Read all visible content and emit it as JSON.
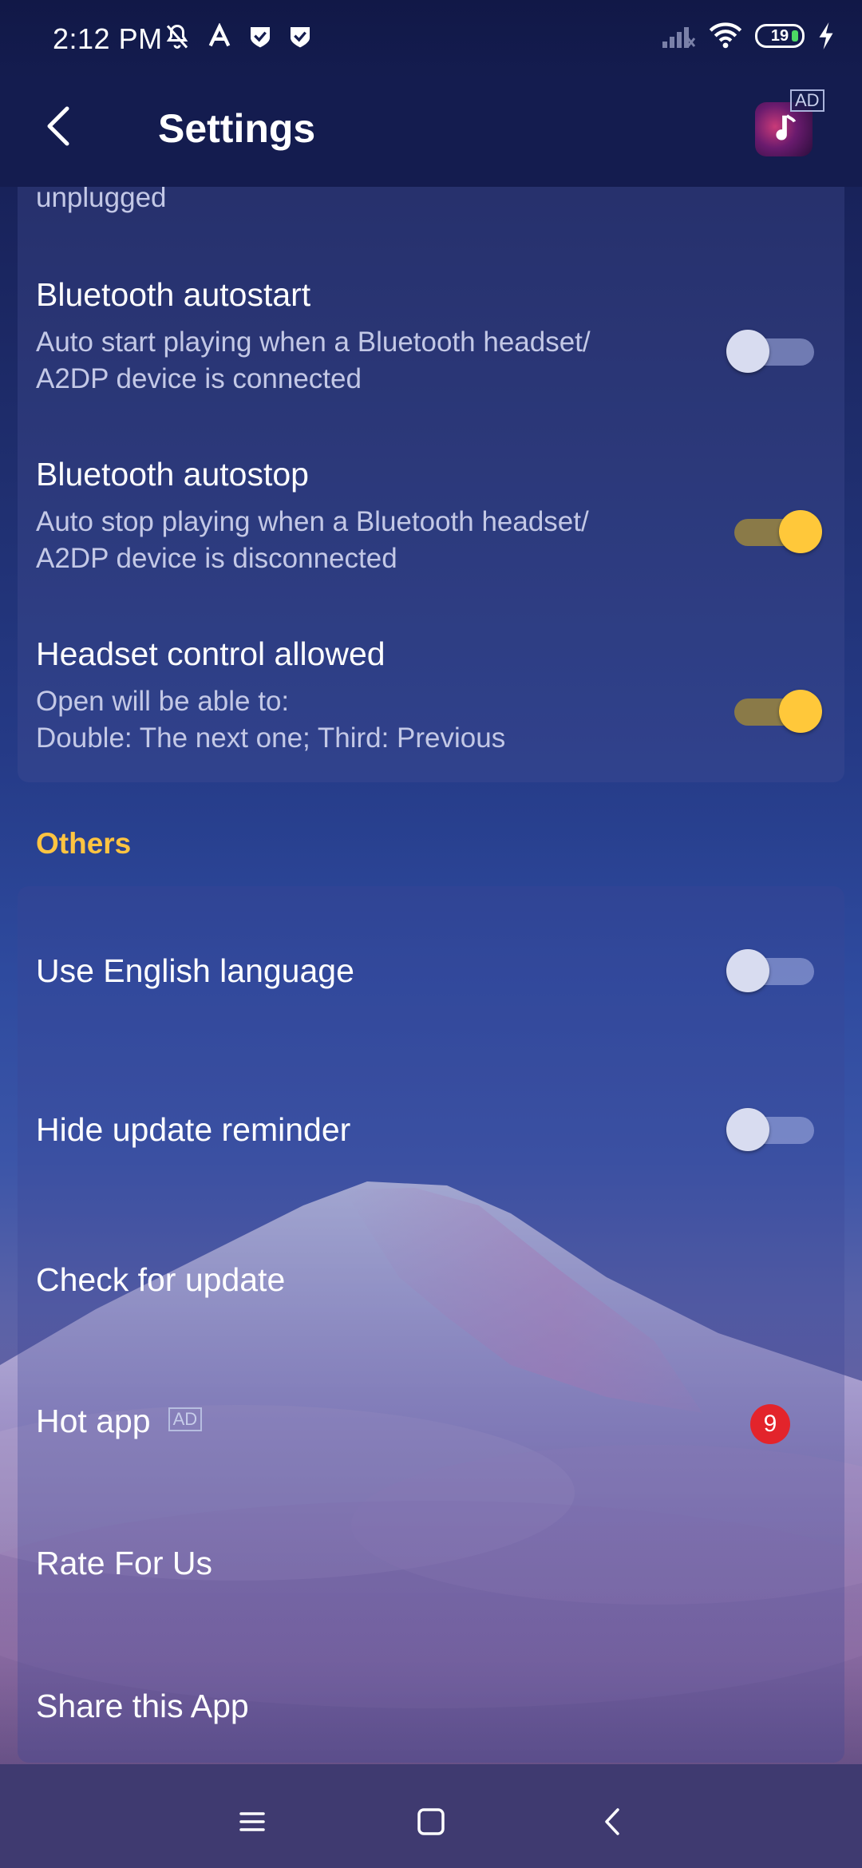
{
  "status_bar": {
    "time": "2:12 PM",
    "battery_level": "19",
    "icons_left": [
      "mute-icon",
      "a-icon",
      "shield-check-icon",
      "shield-check-icon"
    ],
    "icons_right": [
      "signal-icon",
      "wifi-icon",
      "battery-icon",
      "charging-icon"
    ]
  },
  "header": {
    "title": "Settings",
    "ad_tag": "AD"
  },
  "top_card": {
    "cut_text": "unplugged",
    "rows": [
      {
        "title": "Bluetooth autostart",
        "desc_line1": "Auto start playing when a Bluetooth headset/",
        "desc_line2": "A2DP device is connected",
        "toggle_on": false
      },
      {
        "title": "Bluetooth autostop",
        "desc_line1": "Auto stop playing when a Bluetooth headset/",
        "desc_line2": "A2DP device is disconnected",
        "toggle_on": true
      },
      {
        "title": "Headset control allowed",
        "desc_line1": "Open will be able to:",
        "desc_line2": "Double: The next one; Third: Previous",
        "toggle_on": true
      }
    ]
  },
  "others": {
    "section_title": "Others",
    "use_english": {
      "label": "Use English language",
      "toggle_on": false
    },
    "hide_update": {
      "label": "Hide update reminder",
      "toggle_on": false
    },
    "check_update": {
      "label": "Check for update"
    },
    "hot_app": {
      "label": "Hot app",
      "ad_tag": "AD",
      "badge": "9"
    },
    "rate": {
      "label": "Rate For Us"
    },
    "share": {
      "label": "Share this App"
    }
  },
  "colors": {
    "accent_yellow": "#ffc441",
    "toggle_on_knob": "#ffc83a",
    "badge_red": "#e3242b"
  }
}
